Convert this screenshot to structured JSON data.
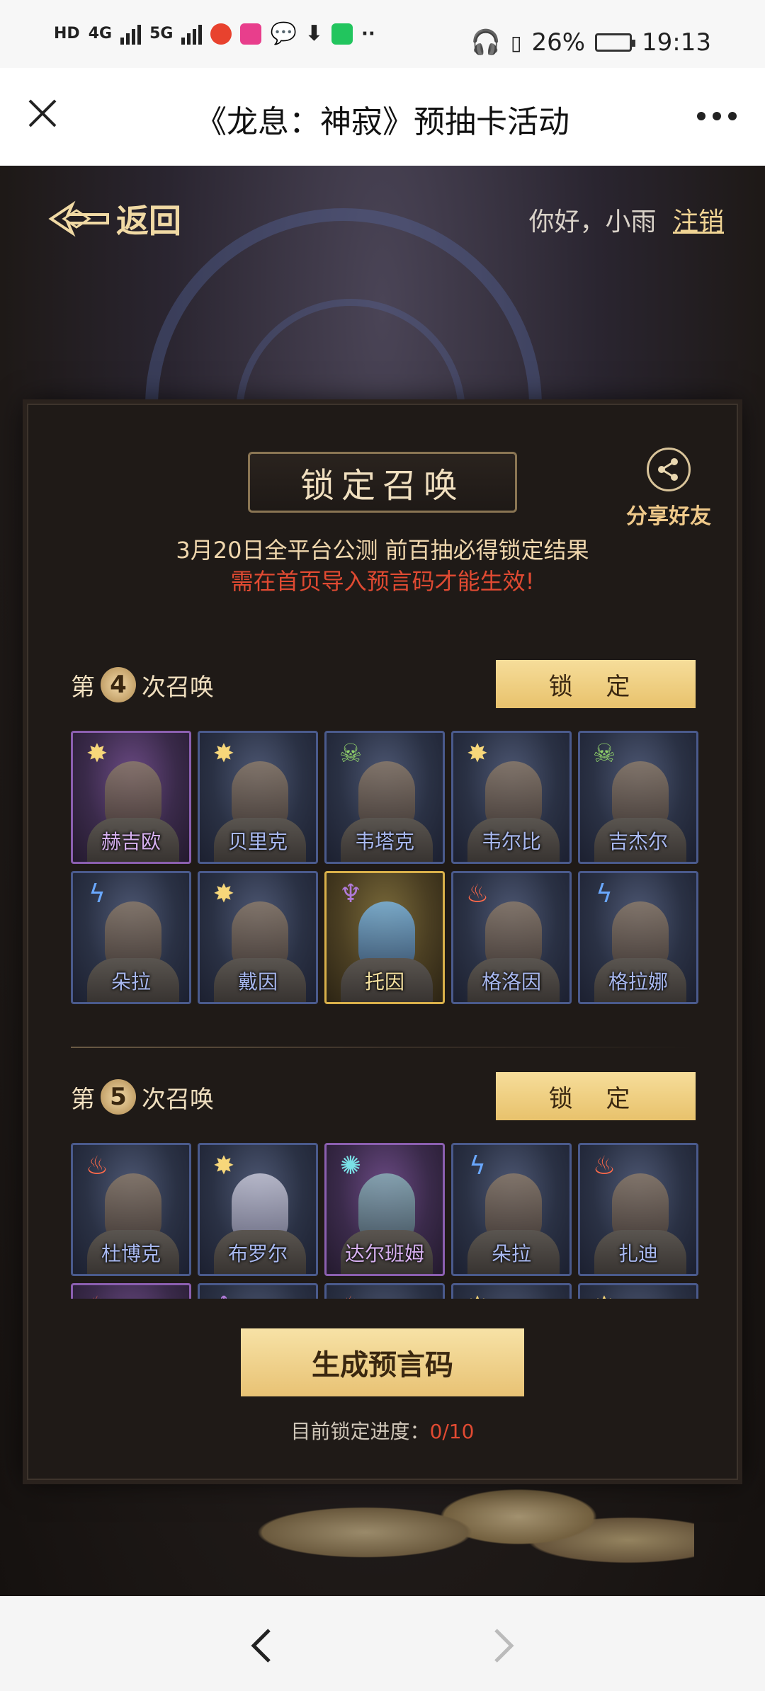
{
  "status": {
    "left_tags": [
      "HD",
      "4G",
      "5G"
    ],
    "battery": "26%",
    "time": "19:13"
  },
  "nav": {
    "title": "《龙息：神寂》预抽卡活动"
  },
  "header": {
    "back_label": "返回",
    "greeting": "你好，小雨",
    "logout_label": "注销"
  },
  "panel": {
    "title": "锁定召唤",
    "share_label": "分享好友",
    "line1": "3月20日全平台公测 前百抽必得锁定结果",
    "line2": "需在首页导入预言码才能生效!"
  },
  "round4": {
    "prefix": "第",
    "number": "4",
    "suffix": "次召唤",
    "lock_label": "锁 定",
    "cards": [
      {
        "name": "赫吉欧",
        "element": "sun"
      },
      {
        "name": "贝里克",
        "element": "sun"
      },
      {
        "name": "韦塔克",
        "element": "skull"
      },
      {
        "name": "韦尔比",
        "element": "sun"
      },
      {
        "name": "吉杰尔",
        "element": "skull"
      },
      {
        "name": "朵拉",
        "element": "bolt"
      },
      {
        "name": "戴因",
        "element": "sun"
      },
      {
        "name": "托因",
        "element": "demon"
      },
      {
        "name": "格洛因",
        "element": "fire"
      },
      {
        "name": "格拉娜",
        "element": "bolt"
      }
    ]
  },
  "round5": {
    "prefix": "第",
    "number": "5",
    "suffix": "次召唤",
    "lock_label": "锁 定",
    "cards": [
      {
        "name": "杜博克",
        "element": "fire"
      },
      {
        "name": "布罗尔",
        "element": "sun"
      },
      {
        "name": "达尔班姆",
        "element": "gear"
      },
      {
        "name": "朵拉",
        "element": "bolt"
      },
      {
        "name": "扎迪",
        "element": "fire"
      }
    ]
  },
  "generate_label": "生成预言码",
  "progress": {
    "label": "目前锁定进度：",
    "value": "0/10"
  }
}
